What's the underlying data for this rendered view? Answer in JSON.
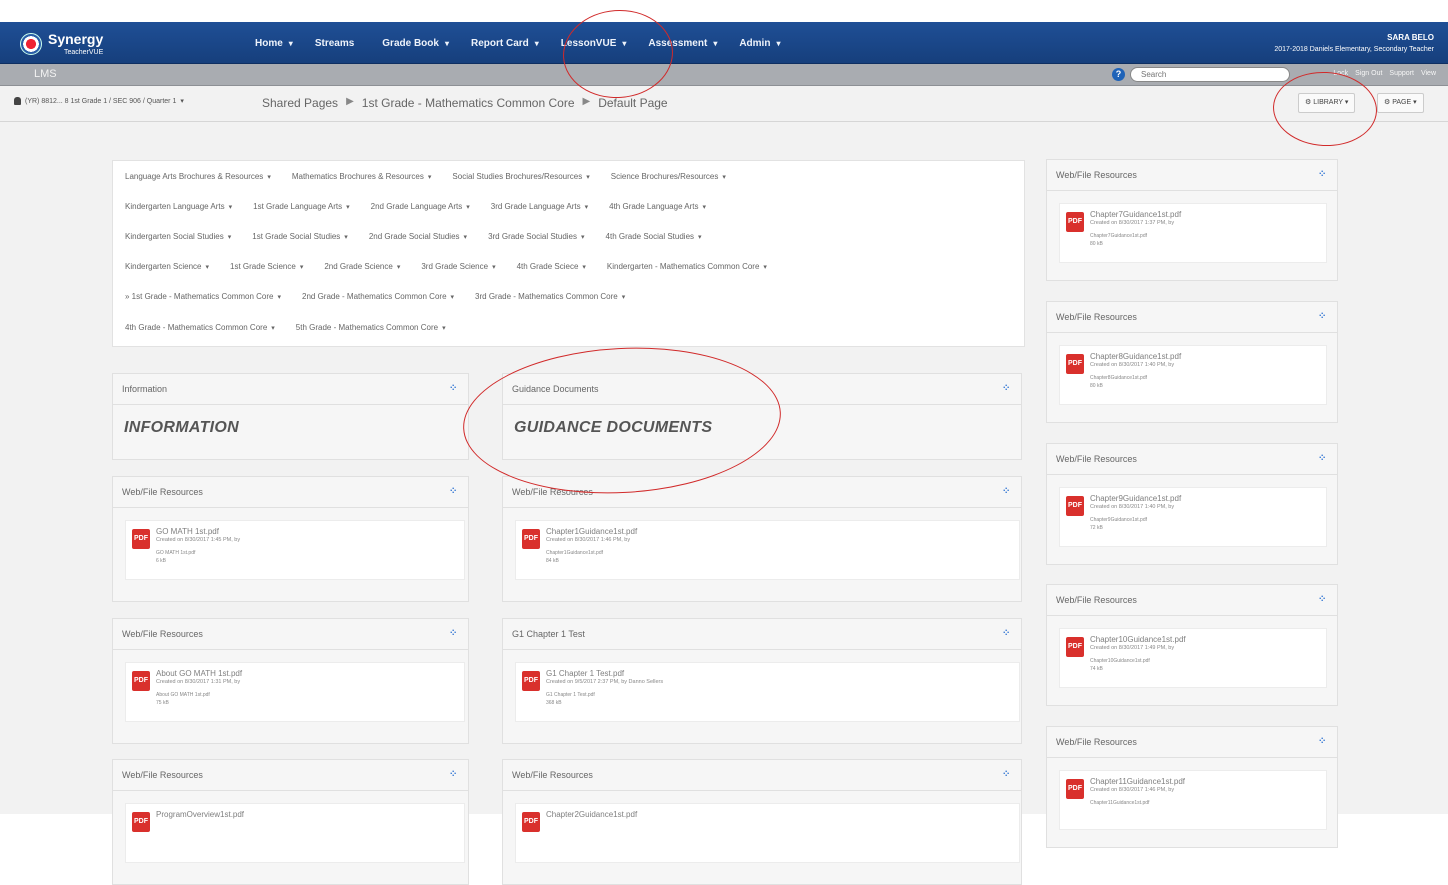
{
  "header": {
    "logo": "Synergy",
    "logo_sub": "TeacherVUE",
    "nav": [
      {
        "label": "Home",
        "caret": "▾"
      },
      {
        "label": "Streams",
        "caret": ""
      },
      {
        "label": "Grade Book",
        "caret": "▾"
      },
      {
        "label": "Report Card",
        "caret": "▾"
      },
      {
        "label": "LessonVUE",
        "caret": "▾"
      },
      {
        "label": "Assessment",
        "caret": "▾"
      },
      {
        "label": "Admin",
        "caret": "▾"
      }
    ],
    "user_name": "SARA BELO",
    "user_detail": "2017-2018 Daniels Elementary, Secondary Teacher"
  },
  "subbar": {
    "title": "LMS",
    "search_placeholder": "Search",
    "links": [
      "Lock",
      "Sign Out",
      "Support",
      "View"
    ]
  },
  "crumbbar": {
    "context": "(YR) 8812... 8 1st Grade 1 / SEC 906 / Quarter 1",
    "crumbs": [
      "Shared Pages",
      "1st Grade - Mathematics Common Core",
      "Default Page"
    ],
    "library_label": "LIBRARY",
    "page_label": "PAGE"
  },
  "links": {
    "rows": [
      [
        "Language Arts Brochures & Resources",
        "Mathematics Brochures & Resources",
        "Social Studies Brochures/Resources",
        "Science Brochures/Resources"
      ],
      [
        "Kindergarten Language Arts",
        "1st Grade Language Arts",
        "2nd Grade Language Arts",
        "3rd Grade Language Arts",
        "4th Grade Language Arts"
      ],
      [
        "Kindergarten Social Studies",
        "1st Grade Social Studies",
        "2nd Grade Social Studies",
        "3rd Grade Social Studies",
        "4th Grade Social Studies"
      ],
      [
        "Kindergarten Science",
        "1st Grade Science",
        "2nd Grade Science",
        "3rd Grade Science",
        "4th Grade Sciece",
        "Kindergarten - Mathematics Common Core"
      ],
      [
        "» 1st Grade - Mathematics Common Core",
        "2nd Grade - Mathematics Common Core",
        "3rd Grade - Mathematics Common Core"
      ],
      [
        "4th Grade - Mathematics Common Core",
        "5th Grade - Mathematics Common Core"
      ]
    ]
  },
  "panels": {
    "information": {
      "header": "Information",
      "title": "INFORMATION"
    },
    "guidance": {
      "header": "Guidance Documents",
      "title": "GUIDANCE DOCUMENTS"
    }
  },
  "file_panels": [
    {
      "header": "Web/File Resources",
      "name": "GO MATH 1st.pdf",
      "meta": "Created on 8/30/2017 1:45 PM, by",
      "orig": "GO MATH 1st.pdf",
      "size": "6 kB"
    },
    {
      "header": "Web/File Resources",
      "name": "Chapter1Guidance1st.pdf",
      "meta": "Created on 8/30/2017 1:46 PM, by",
      "orig": "Chapter1Guidance1st.pdf",
      "size": "84 kB"
    },
    {
      "header": "Web/File Resources",
      "name": "About GO MATH 1st.pdf",
      "meta": "Created on 8/30/2017 1:31 PM, by",
      "orig": "About GO MATH 1st.pdf",
      "size": "75 kB"
    },
    {
      "header": "G1 Chapter 1 Test",
      "name": "G1 Chapter 1 Test.pdf",
      "meta": "Created on 9/5/2017 2:37 PM, by Danno Sellers",
      "orig": "G1 Chapter 1 Test.pdf",
      "size": "368 kB"
    },
    {
      "header": "Web/File Resources",
      "name": "ProgramOverview1st.pdf",
      "meta": "",
      "orig": "",
      "size": ""
    },
    {
      "header": "Web/File Resources",
      "name": "Chapter2Guidance1st.pdf",
      "meta": "",
      "orig": "",
      "size": ""
    }
  ],
  "side_panels": [
    {
      "header": "Web/File Resources",
      "name": "Chapter7Guidance1st.pdf",
      "meta": "Created on 8/30/2017 1:37 PM, by",
      "orig": "Chapter7Guidance1st.pdf",
      "size": "80 kB"
    },
    {
      "header": "Web/File Resources",
      "name": "Chapter8Guidance1st.pdf",
      "meta": "Created on 8/30/2017 1:40 PM, by",
      "orig": "Chapter8Guidance1st.pdf",
      "size": "80 kB"
    },
    {
      "header": "Web/File Resources",
      "name": "Chapter9Guidance1st.pdf",
      "meta": "Created on 8/30/2017 1:40 PM, by",
      "orig": "Chapter9Guidance1st.pdf",
      "size": "72 kB"
    },
    {
      "header": "Web/File Resources",
      "name": "Chapter10Guidance1st.pdf",
      "meta": "Created on 8/30/2017 1:49 PM, by",
      "orig": "Chapter10Guidance1st.pdf",
      "size": "74 kB"
    },
    {
      "header": "Web/File Resources",
      "name": "Chapter11Guidance1st.pdf",
      "meta": "Created on 8/30/2017 1:46 PM, by",
      "orig": "Chapter11Guidance1st.pdf",
      "size": ""
    }
  ],
  "icons": {
    "pdf": "pdf-file-icon",
    "expand": "expand-icon",
    "gear": "gear-icon",
    "help": "help-icon",
    "person": "person-icon"
  },
  "colors": {
    "header_blue": "#1f4f96",
    "annotation_red": "#d12a2a",
    "pdf_red": "#d9302c"
  }
}
